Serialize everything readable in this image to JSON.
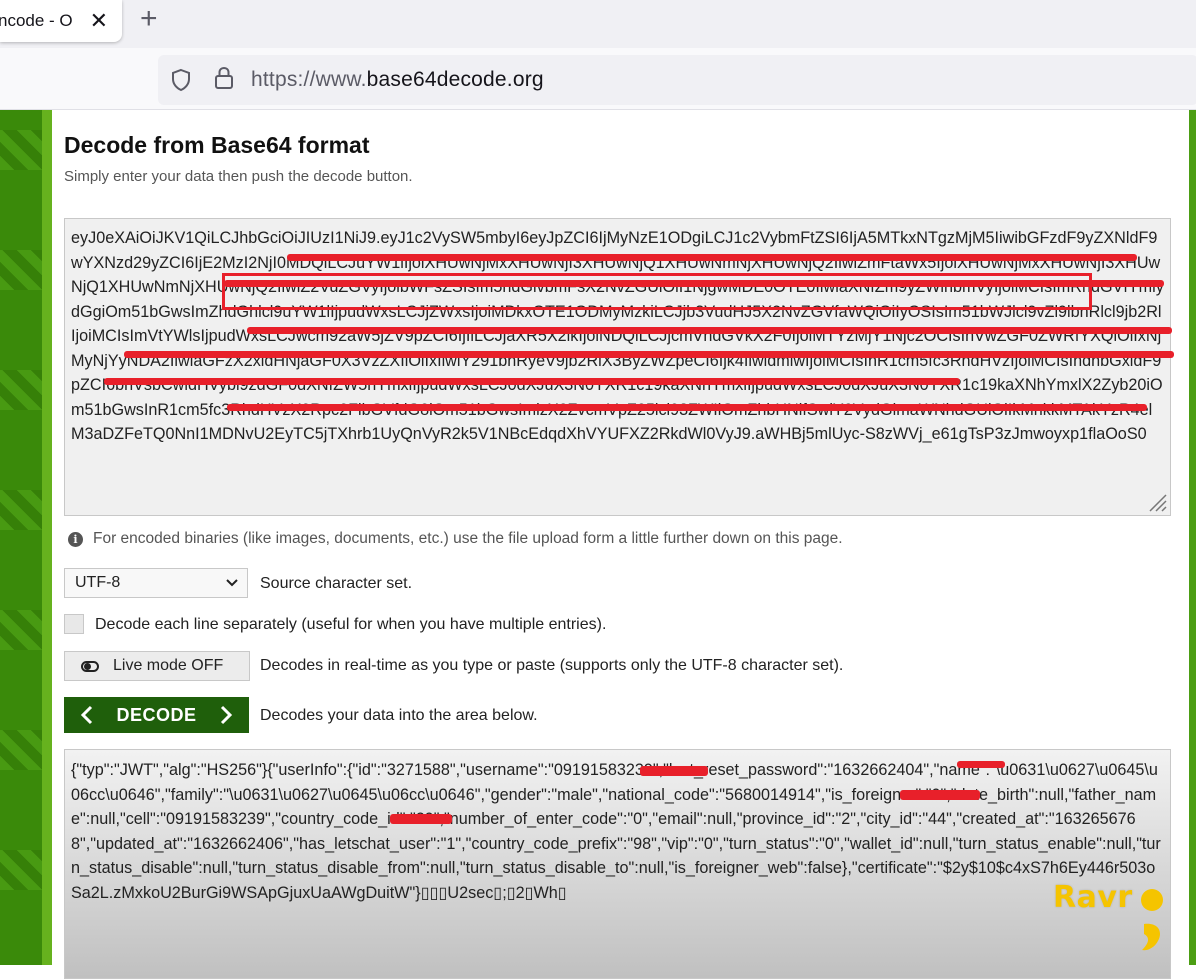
{
  "browser": {
    "tab_title": "ncode - O",
    "tab_close": "✕",
    "new_tab": "+",
    "url_prefix": "https://www.",
    "url_domain": "base64decode.org"
  },
  "page": {
    "title": "Decode from Base64 format",
    "subtitle": "Simply enter your data then push the decode button.",
    "input_text": "eyJ0eXAiOiJKV1QiLCJhbGciOiJIUzI1NiJ9.eyJ1c2VySW5mbyI6eyJpZCI6IjMyNzE1ODgiLCJ1c2VybmFtZSI6IjA5MTkxNTgzMjM5IiwibGFzdF9yZXNldF9wYXNzd29yZCI6IjE2MzI2NjI0MDQiLCJuYW1lIjoiXHUwNjMxXHUwNjI3XHUwNjQ1XHUwNmNjXHUwNjQ2IiwiZmFtaWx5IjoiXHUwNjMxXHUwNjI3XHUwNjQ1XHUwNmNjXHUwNjQ2IiwiZ2VuZGVyIjoibWFsZSIsIm5hdGlvbmFsX2NvZGUiOiI1NjgwMDE0OTE0IiwiaXNfZm9yZWlnbmVyIjoiMCIsImRhdGVfYmlydGgiOm51bGwsImZhdGhlcl9uYW1lIjpudWxsLCJjZWxsIjoiMDkxOTE1ODMyMzkiLCJjb3VudHJ5X2NvZGVfaWQiOiIyOSIsIm51bWJlcl9vZl9lbnRlcl9jb2RlIjoiMCIsImVtYWlsIjpudWxsLCJwcm92aW5jZV9pZCI6IjIiLCJjaXR5X2lkIjoiNDQiLCJjcmVhdGVkX2F0IjoiMTYzMjY1Njc2OCIsInVwZGF0ZWRfYXQiOiIxNjMyNjYyNDA2IiwiaGFzX2xldHNjaGF0X3VzZXIiOiIxIiwiY291bnRyeV9jb2RlX3ByZWZpeCI6Ijk4IiwidmlwIjoiMCIsInR1cm5fc3RhdHVzIjoiMCIsIndhbGxldF9pZCI6bnVsbCwidHVybl9zdGF0dXNfZW5hYmxlIjpudWxsLCJ0dXJuX3N0YXR1c19kaXNhYmxlIjpudWxsLCJ0dXJuX3N0YXR1c19kaXNhYmxlX2Zyb20iOm51bGwsInR1cm5fc3RhdHVzX2Rpc2FibGVfdG8iOm51bGwsImlzX2ZvcmVpZ25lcl93ZWIiOmZhbHNlfSwiY2VydGlmaWNhdGUiOiIkMnkkMTAkYzR4elM3aDZFeTQ0NnI1MDNvU2EyTC5jTXhrb1UyQnVyR2k5V1NBcEdqdXhVYUFXZ2RkdWl0VyJ9.aWHBj5mlUyc-S8zWVj_e61gTsP3zJmwoyxp1flaOoS0",
    "info_icon": "i",
    "info_text": "For encoded binaries (like images, documents, etc.) use the file upload form a little further down on this page.",
    "charset_value": "UTF-8",
    "charset_label": "Source character set.",
    "each_line_label": "Decode each line separately (useful for when you have multiple entries).",
    "live_mode_label": "Live mode OFF",
    "live_mode_desc": "Decodes in real-time as you type or paste (supports only the UTF-8 character set).",
    "decode_label": "DECODE",
    "decode_desc": "Decodes your data into the area below.",
    "output_text": "{\"typ\":\"JWT\",\"alg\":\"HS256\"}{\"userInfo\":{\"id\":\"3271588\",\"username\":\"09191583239\",\"last_reset_password\":\"1632662404\",\"name\":\"\\u0631\\u0627\\u0645\\u06cc\\u0646\",\"family\":\"\\u0631\\u0627\\u0645\\u06cc\\u0646\",\"gender\":\"male\",\"national_code\":\"5680014914\",\"is_foreigner\":\"0\",\"date_birth\":null,\"father_name\":null,\"cell\":\"09191583239\",\"country_code_id\":\"29\",\"number_of_enter_code\":\"0\",\"email\":null,\"province_id\":\"2\",\"city_id\":\"44\",\"created_at\":\"1632656768\",\"updated_at\":\"1632662406\",\"has_letschat_user\":\"1\",\"country_code_prefix\":\"98\",\"vip\":\"0\",\"turn_status\":\"0\",\"wallet_id\":null,\"turn_status_enable\":null,\"turn_status_disable\":null,\"turn_status_disable_from\":null,\"turn_status_disable_to\":null,\"is_foreigner_web\":false},\"certificate\":\"$2y$10$c4xS7h6Ey446r503oSa2L.zMxkoU2BurGi9WSApGjuxUaAWgDuitW\"}▯▯▯U2sec▯;▯2▯Wh▯",
    "watermark": "Ravr"
  },
  "colors": {
    "brand_green": "#3a8a0a",
    "decode_button": "#1f5f0b",
    "redaction": "#e8202a",
    "watermark": "#f5c400"
  }
}
